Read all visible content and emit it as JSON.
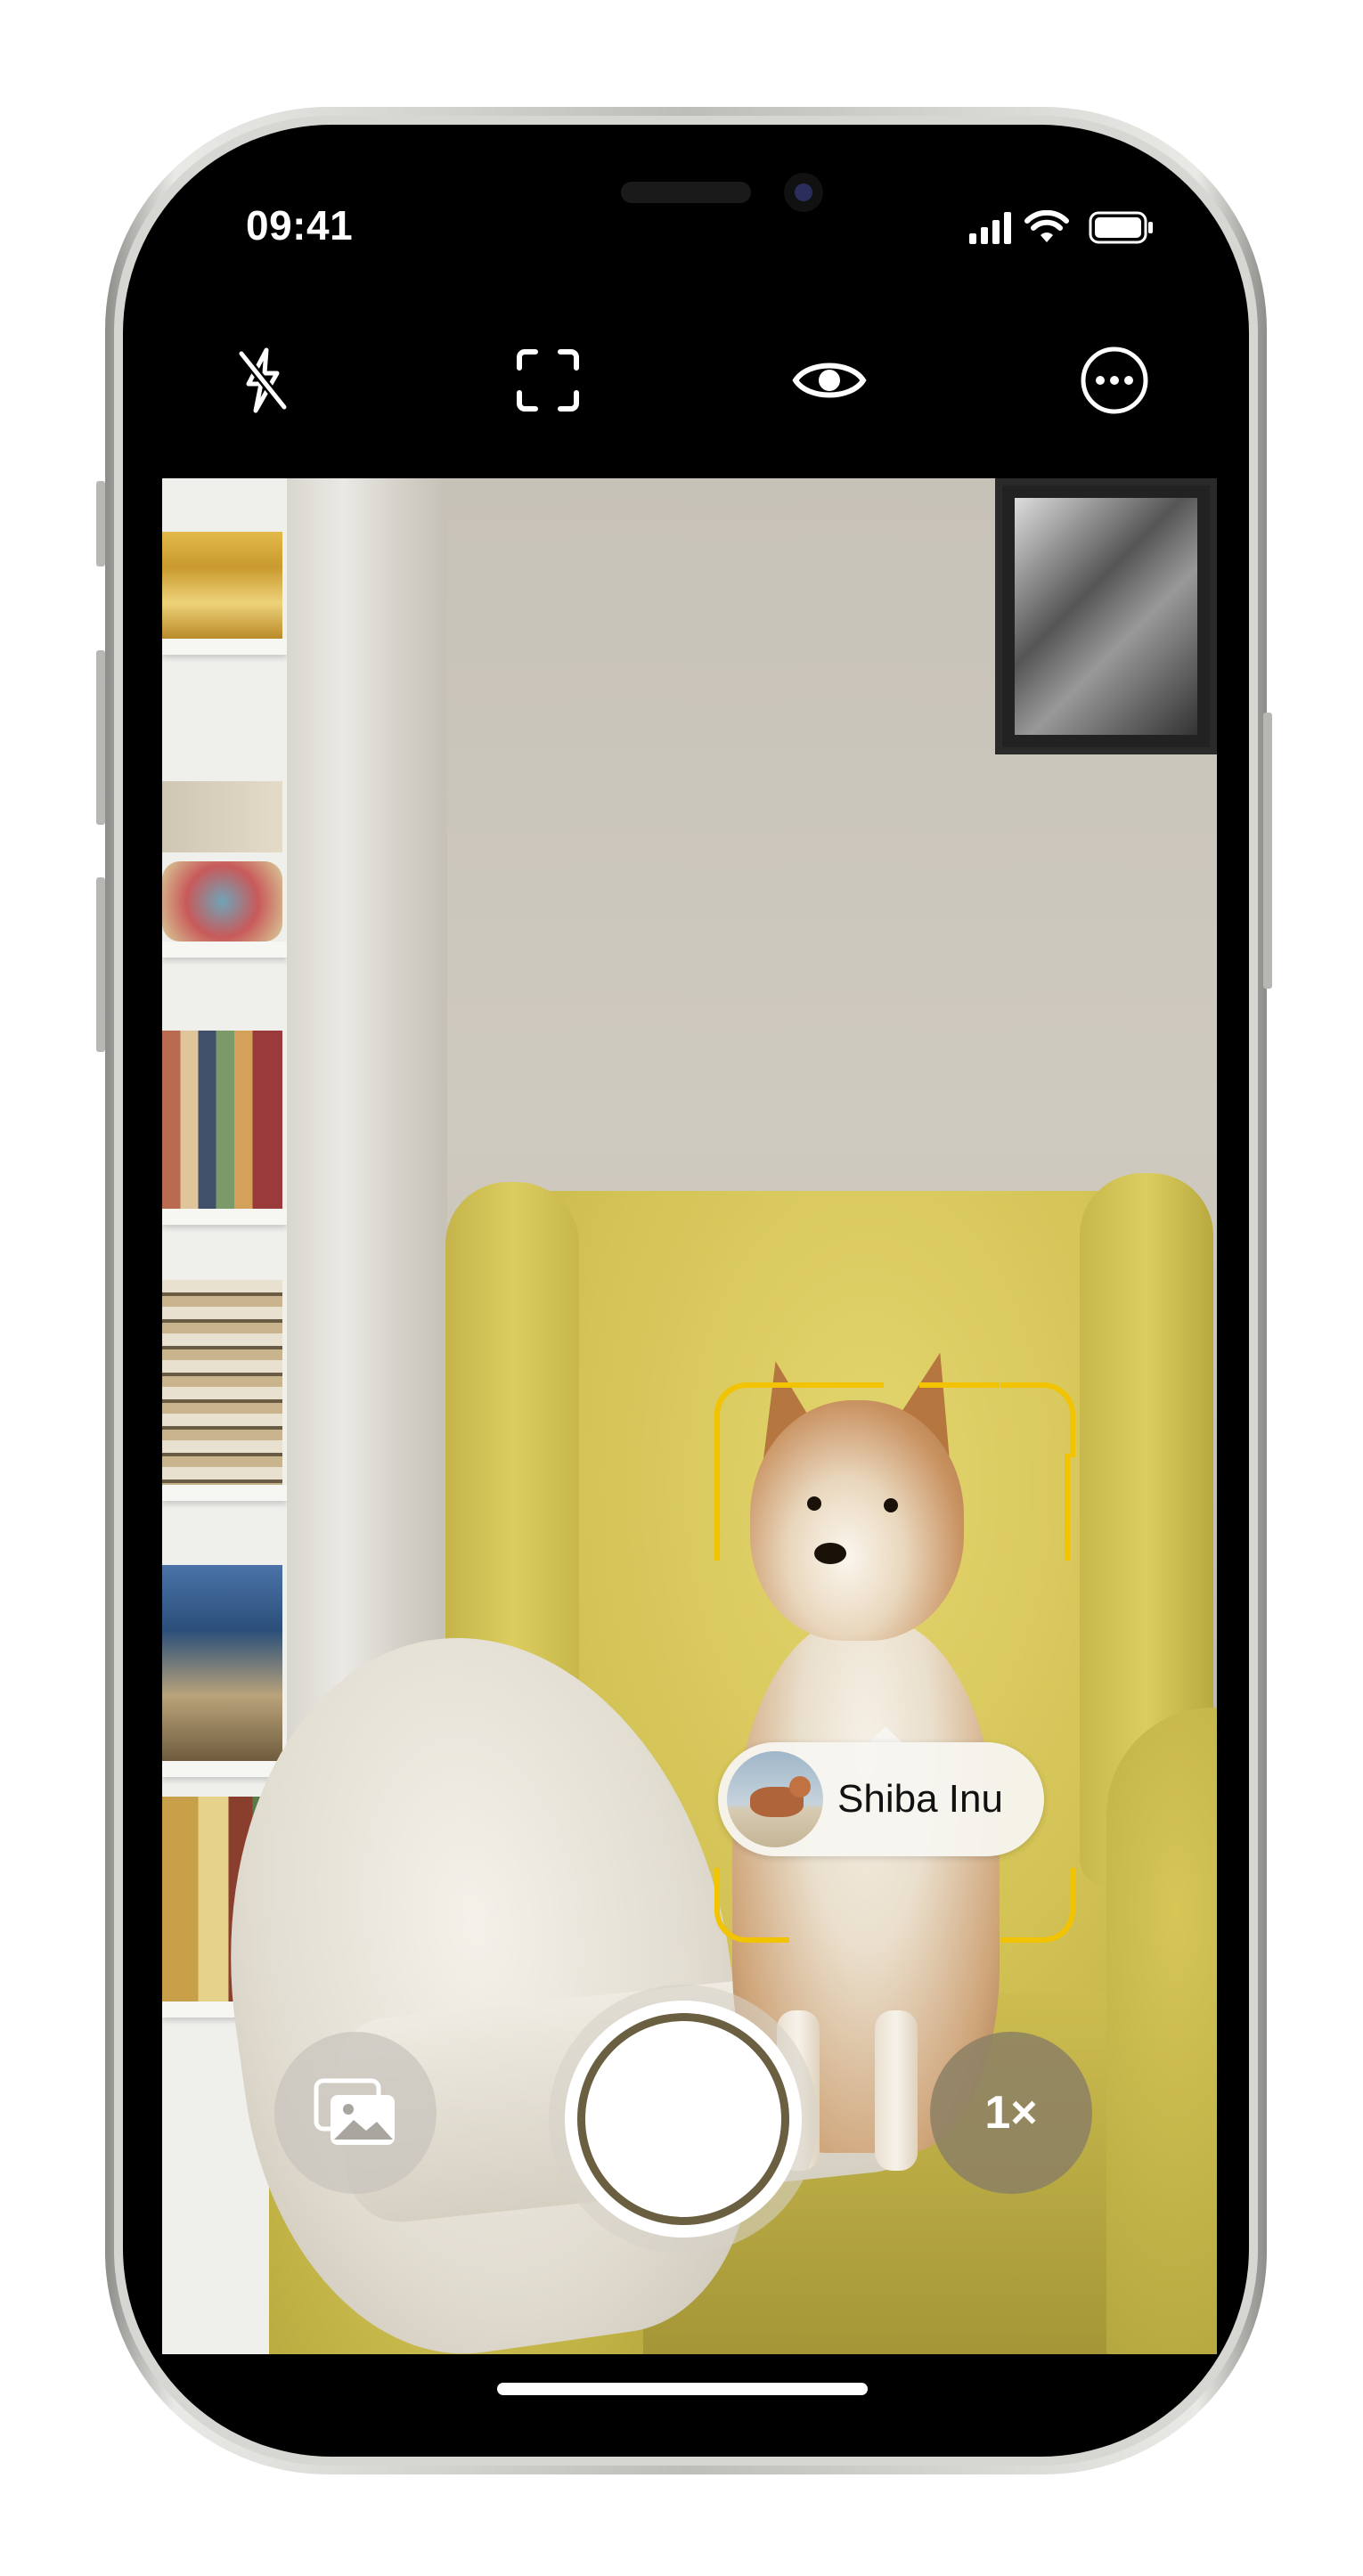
{
  "status_bar": {
    "time": "09:41"
  },
  "toolbar": {
    "items": [
      {
        "icon": "flash-off-icon"
      },
      {
        "icon": "scan-frame-icon"
      },
      {
        "icon": "eye-icon"
      },
      {
        "icon": "more-options-icon"
      }
    ]
  },
  "detection": {
    "label": "Shiba Inu",
    "bracket_color": "#f1c300"
  },
  "controls": {
    "photo_library_icon": "photo-library-icon",
    "zoom_label": "1×"
  }
}
